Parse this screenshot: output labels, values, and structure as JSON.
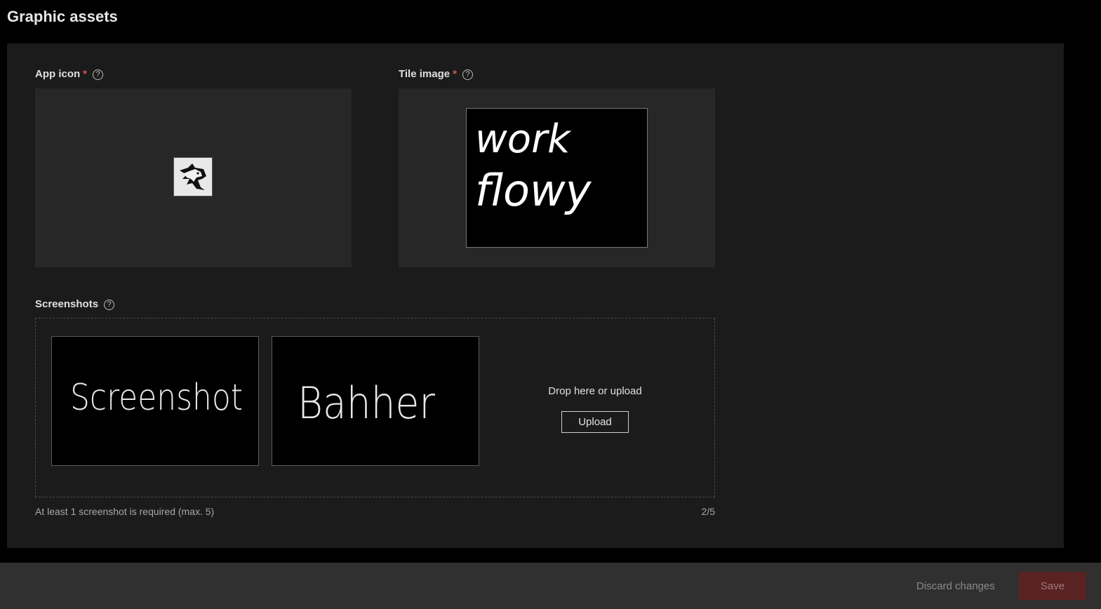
{
  "page": {
    "title": "Graphic assets"
  },
  "app_icon": {
    "label": "App icon",
    "required_mark": "*",
    "help": "?",
    "icon": "fox-logo-icon"
  },
  "tile_image": {
    "label": "Tile image",
    "required_mark": "*",
    "help": "?",
    "image_text_line1": "work",
    "image_text_line2": "flowy"
  },
  "screenshots": {
    "label": "Screenshots",
    "help": "?",
    "items": [
      {
        "caption": "Screenshot"
      },
      {
        "caption": "Bahher"
      }
    ],
    "drop_text": "Drop here or upload",
    "upload_label": "Upload",
    "hint": "At least 1 screenshot is required (max. 5)",
    "count": "2/5"
  },
  "footer": {
    "discard_label": "Discard changes",
    "save_label": "Save"
  },
  "colors": {
    "background": "#000000",
    "panel": "#1b1b1b",
    "asset_box": "#272727",
    "footer": "#303030",
    "required": "#d9534f",
    "save_button": "#5a2222"
  }
}
